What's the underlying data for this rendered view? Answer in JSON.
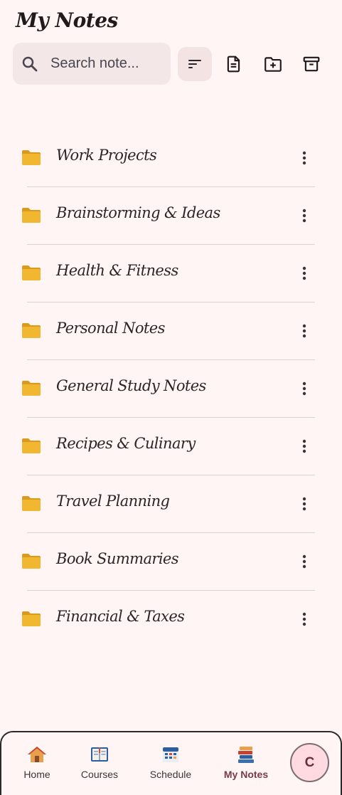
{
  "app": {
    "title": "My Notes"
  },
  "search": {
    "placeholder": "Search note..."
  },
  "toolbar": {
    "sort_icon": "sort-icon",
    "new_note_icon": "note-add-icon",
    "new_folder_icon": "folder-add-icon",
    "archive_icon": "archive-icon"
  },
  "folders": [
    {
      "name": "Work Projects"
    },
    {
      "name": "Brainstorming & Ideas"
    },
    {
      "name": "Health & Fitness"
    },
    {
      "name": "Personal Notes"
    },
    {
      "name": "General Study Notes"
    },
    {
      "name": "Recipes & Culinary"
    },
    {
      "name": "Travel Planning"
    },
    {
      "name": "Book Summaries"
    },
    {
      "name": "Financial & Taxes"
    }
  ],
  "bottom_nav": {
    "items": [
      {
        "label": "Home",
        "icon": "home-icon"
      },
      {
        "label": "Courses",
        "icon": "book-icon"
      },
      {
        "label": "Schedule",
        "icon": "calendar-icon"
      },
      {
        "label": "My Notes",
        "icon": "books-icon",
        "active": true
      }
    ],
    "avatar_initial": "C"
  },
  "colors": {
    "background": "#fff5f4",
    "search_bg": "#f3e7e7",
    "active_label": "#7a3a4c",
    "avatar_bg": "#ffdbe1",
    "folder": "#f2b731"
  }
}
